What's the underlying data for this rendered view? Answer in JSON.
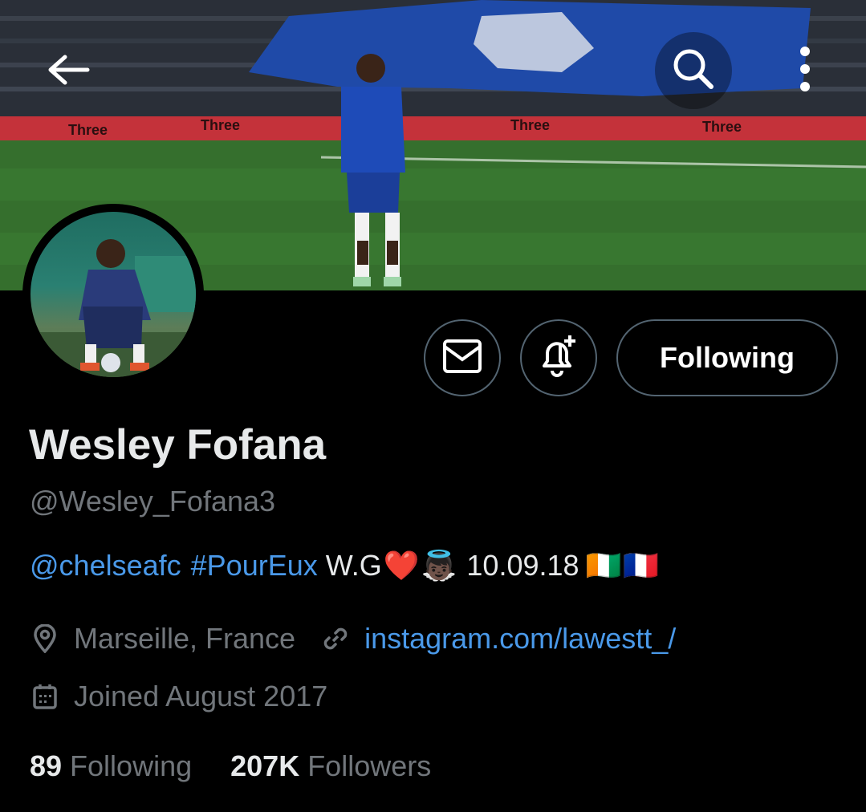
{
  "profile": {
    "name": "Wesley Fofana",
    "handle": "@Wesley_Fofana3",
    "bio": {
      "mention": "@chelseafc",
      "hashtag": "#PourEux",
      "text": "W.G",
      "heart": "❤️",
      "angel": "👼🏿",
      "date": "10.09.18",
      "flag_ci": "🇨🇮",
      "flag_fr": "🇫🇷"
    },
    "location": "Marseille, France",
    "website": "instagram.com/lawestt_/",
    "joined": "Joined August 2017"
  },
  "stats": {
    "following_count": "89",
    "following_label": "Following",
    "followers_count": "207K",
    "followers_label": "Followers"
  },
  "actions": {
    "follow_label": "Following"
  },
  "banner": {
    "boards": [
      "Three",
      "Three",
      "Three",
      "Three"
    ]
  },
  "icons": {
    "back": "arrow-left-icon",
    "search": "search-icon",
    "more": "more-vertical-icon",
    "dm": "envelope-icon",
    "notify": "bell-plus-icon",
    "location": "location-pin-icon",
    "link": "link-icon",
    "calendar": "calendar-icon"
  },
  "colors": {
    "background": "#000000",
    "primary_text": "#e7e9ea",
    "secondary_text": "#71767b",
    "link": "#4a99e9",
    "border": "#536471",
    "chelsea_blue": "#034694"
  }
}
